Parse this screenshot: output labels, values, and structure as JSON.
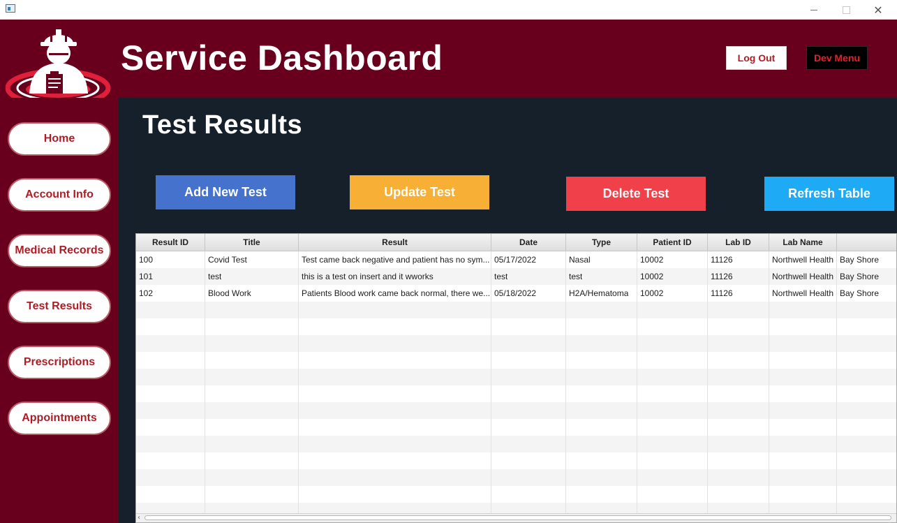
{
  "window": {
    "controls": {
      "minimize_icon": "minimize-icon",
      "maximize_icon": "maximize-icon",
      "close_icon": "close-icon",
      "close_glyph": "✕"
    }
  },
  "header": {
    "title": "Service Dashboard",
    "logout_label": "Log Out",
    "dev_menu_label": "Dev Menu",
    "logo_icon": "worker-helmet-logo"
  },
  "sidebar": {
    "items": [
      {
        "label": "Home"
      },
      {
        "label": "Account Info"
      },
      {
        "label": "Medical Records"
      },
      {
        "label": "Test Results"
      },
      {
        "label": "Prescriptions"
      },
      {
        "label": "Appointments"
      }
    ]
  },
  "main": {
    "page_title": "Test Results",
    "actions": {
      "add": "Add New Test",
      "update": "Update Test",
      "delete": "Delete Test",
      "refresh": "Refresh Table"
    },
    "table": {
      "columns": [
        "Result ID",
        "Title",
        "Result",
        "Date",
        "Type",
        "Patient ID",
        "Lab ID",
        "Lab Name",
        ""
      ],
      "rows": [
        [
          "100",
          "Covid Test",
          "Test came back negative and patient has no sym...",
          "05/17/2022",
          "Nasal",
          "10002",
          "11126",
          "Northwell Health",
          "Bay Shore"
        ],
        [
          "101",
          "test",
          "this is a test on insert and it wworks",
          "test",
          "test",
          "10002",
          "11126",
          "Northwell Health",
          "Bay Shore"
        ],
        [
          "102",
          "Blood Work",
          "Patients Blood work came back normal, there we...",
          "05/18/2022",
          "H2A/Hematoma",
          "10002",
          "11126",
          "Northwell Health",
          "Bay Shore"
        ]
      ]
    }
  },
  "colors": {
    "brand": "#68001d",
    "content_bg": "#15202b",
    "add": "#4472cc",
    "update": "#f7b035",
    "delete": "#f0414a",
    "refresh": "#1eaaf5"
  }
}
